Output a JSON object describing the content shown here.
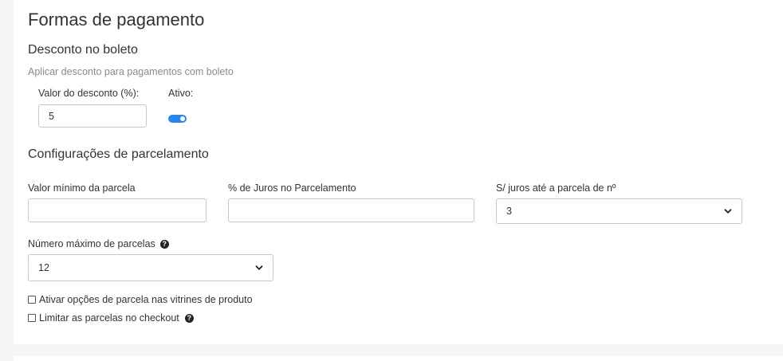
{
  "page": {
    "title": "Formas de pagamento"
  },
  "boleto": {
    "heading": "Desconto no boleto",
    "help": "Aplicar desconto para pagamentos com boleto",
    "discount_label": "Valor do desconto (%):",
    "discount_value": "5",
    "active_label": "Ativo:",
    "active": true
  },
  "installments": {
    "heading": "Configurações de parcelamento",
    "min_label": "Valor mínimo da parcela",
    "min_value": "",
    "interest_label": "% de Juros no Parcelamento",
    "interest_value": "",
    "no_interest_label": "S/ juros até a parcela de nº",
    "no_interest_value": "3",
    "max_label": "Número máximo de parcelas",
    "max_value": "12",
    "showcase_label": "Ativar opções de parcela nas vitrines de produto",
    "showcase_checked": false,
    "limit_label": "Limitar as parcelas no checkout",
    "limit_checked": false
  },
  "icons": {
    "help": "question-circle-icon",
    "select": "chevron-down-icon"
  },
  "colors": {
    "toggle_on": "#2a85e8"
  }
}
